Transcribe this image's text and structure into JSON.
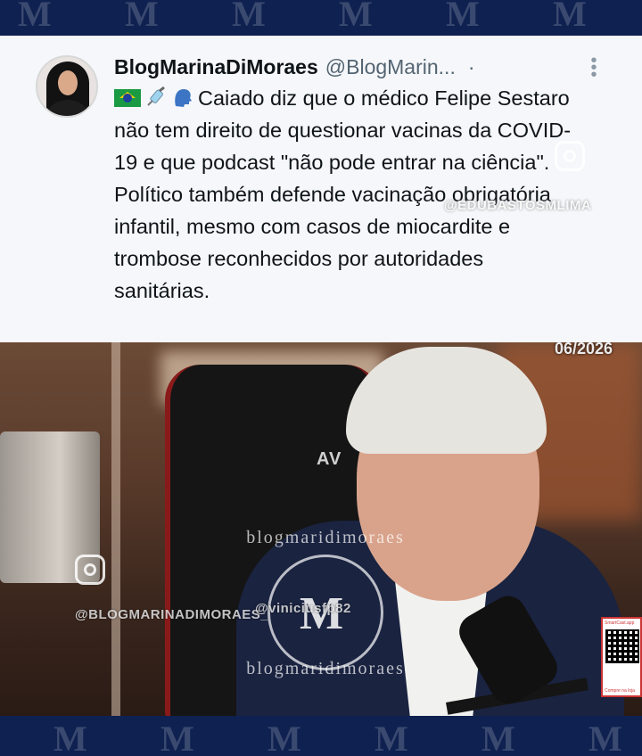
{
  "frame": {
    "band_letter": "M",
    "band_color": "#0f2150"
  },
  "tweet": {
    "display_name": "BlogMarinaDiMoraes",
    "handle": "@BlogMarin...",
    "separator": "·",
    "more_icon": "⋮",
    "emojis": [
      "flag-brazil-icon",
      "syringe-icon",
      "speaking-head-icon"
    ],
    "text": "Caiado diz que o médico Felipe Sestaro não tem direito de questionar vacinas da COVID-19 e que podcast \"não pode entrar na ciência\". Político também defende vacinação obrigatória infantil, mesmo com casos de miocardite e trombose reconhecidos por autoridades sanitárias.",
    "watermark": "@EDUBASTOSMLIMA"
  },
  "video": {
    "date_stamp": "06/2026",
    "chair_brand": "AV",
    "watermark_left": "@BLOGMARINADIMORAES_",
    "watermark_center": "@viniciusfp82",
    "seal_text": "blogmaridimoraes",
    "seal_letter": "M",
    "qr_title": "SmartCast.app",
    "qr_footer": "Compre na loja"
  }
}
